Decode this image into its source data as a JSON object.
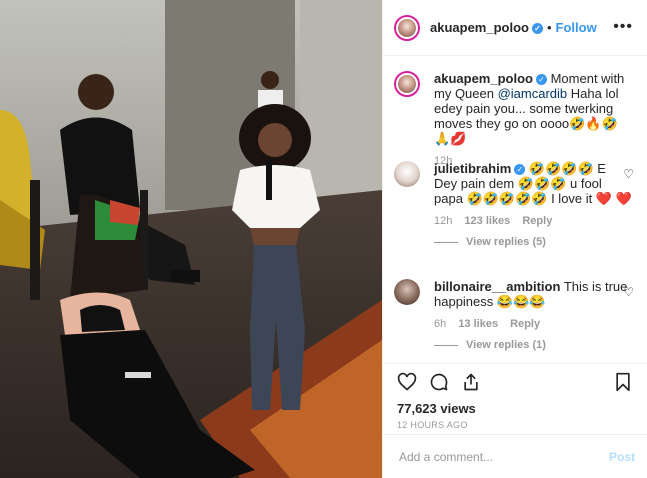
{
  "post": {
    "username": "akuapem_poloo",
    "follow_label": "Follow",
    "more_label": "•••",
    "separator": "•"
  },
  "caption": {
    "username": "akuapem_poloo",
    "text_before": "Moment with my Queen ",
    "mention": "@iamcardib",
    "text_after": " Haha lol edey pain you... some twerking moves they go on oooo🤣🔥🤣🙏💋",
    "time": "12h"
  },
  "comments": [
    {
      "username": "julietibrahim",
      "text": "🤣🤣🤣🤣 E Dey pain dem 🤣🤣🤣 u fool papa 🤣🤣🤣🤣🤣 I love it ❤️ ❤️",
      "time": "12h",
      "likes": "123 likes",
      "reply_label": "Reply",
      "view_replies": "View replies (5)"
    },
    {
      "username": "billonaire__ambition",
      "text": "This is true happiness 😂😂😂",
      "time": "6h",
      "likes": "13 likes",
      "reply_label": "Reply",
      "view_replies": "View replies (1)"
    }
  ],
  "stats": {
    "views": "77,623 views",
    "time_ago": "12 HOURS AGO"
  },
  "comment_box": {
    "placeholder": "Add a comment...",
    "post_label": "Post"
  },
  "icons": {
    "like": "heart-icon",
    "comment": "comment-icon",
    "share": "share-icon",
    "save": "bookmark-icon",
    "verified": "verified-badge-icon"
  },
  "colors": {
    "link": "#3897f0",
    "mention": "#003569",
    "muted": "#999999",
    "post_disabled": "#b2dffc"
  }
}
